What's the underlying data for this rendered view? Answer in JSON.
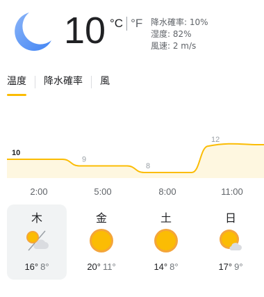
{
  "current": {
    "temperature": "10",
    "unit_c": "°C",
    "unit_f": "°F",
    "icon": "moon-icon",
    "details": [
      "降水確率: 10%",
      "湿度: 82%",
      "風速: 2 m/s"
    ]
  },
  "tabs": [
    {
      "label": "温度",
      "active": true
    },
    {
      "label": "降水確率",
      "active": false
    },
    {
      "label": "風",
      "active": false
    }
  ],
  "chart_data": {
    "type": "area",
    "x": [
      "2:00",
      "5:00",
      "8:00",
      "11:00"
    ],
    "points": [
      10,
      9,
      8,
      12
    ],
    "data_labels": [
      "10",
      "9",
      "8",
      "12"
    ],
    "series_color": "#fbbc04",
    "fill_color": "#fef7e0"
  },
  "times": [
    "2:00",
    "5:00",
    "8:00",
    "11:00"
  ],
  "days": [
    {
      "name": "木",
      "high": "16°",
      "low": "8°",
      "icon": "partly-cloudy-icon",
      "selected": true
    },
    {
      "name": "金",
      "high": "20°",
      "low": "11°",
      "icon": "sun-icon",
      "selected": false
    },
    {
      "name": "土",
      "high": "14°",
      "low": "8°",
      "icon": "sun-icon",
      "selected": false
    },
    {
      "name": "日",
      "high": "17°",
      "low": "9°",
      "icon": "mostly-sunny-icon",
      "selected": false
    }
  ],
  "colors": {
    "moon": "#4285f4",
    "sun": "#fbbc04",
    "sun_outer": "#f4a53a",
    "cloud": "#dadce0"
  }
}
